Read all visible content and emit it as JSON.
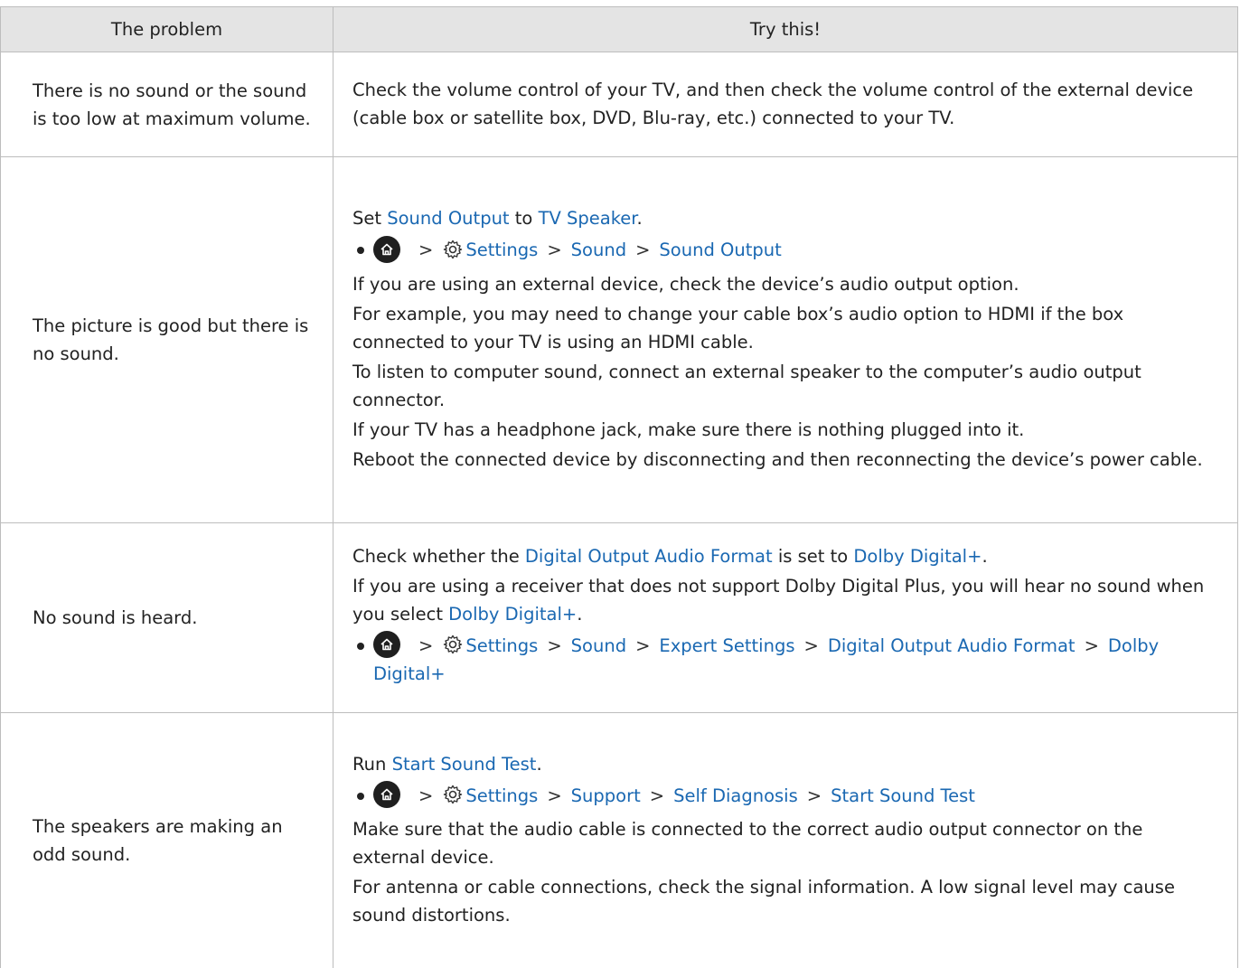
{
  "header": {
    "col1": "The problem",
    "col2": "Try this!"
  },
  "nav": {
    "settings": "Settings",
    "sound": "Sound",
    "sound_output": "Sound Output",
    "expert_settings": "Expert Settings",
    "digital_output_audio_format": "Digital Output Audio Format",
    "dolby_digital_plus": "Dolby Digital+",
    "support": "Support",
    "self_diagnosis": "Self Diagnosis",
    "start_sound_test": "Start Sound Test",
    "tv_speaker": "TV Speaker"
  },
  "rows": [
    {
      "problem": "There is no sound or the sound is too low at maximum volume.",
      "solution": "Check the volume control of your TV, and then check the volume control of the external device (cable box or satellite box, DVD, Blu-ray, etc.) connected to your TV."
    },
    {
      "problem": "The picture is good but there is no sound.",
      "intro_a": "Set ",
      "intro_b": " to ",
      "intro_c": ".",
      "p1": "If you are using an external device, check the device’s audio output option.",
      "p2": "For example, you may need to change your cable box’s audio option to HDMI if the box connected to your TV is using an HDMI cable.",
      "p3": "To listen to computer sound, connect an external speaker to the computer’s audio output connector.",
      "p4": "If your TV has a headphone jack, make sure there is nothing plugged into it.",
      "p5": "Reboot the connected device by disconnecting and then reconnecting the device’s power cable."
    },
    {
      "problem": "No sound is heard.",
      "intro_a": "Check whether the ",
      "intro_b": " is set to ",
      "intro_c": ".",
      "p1a": "If you are using a receiver that does not support Dolby Digital Plus, you will hear no sound when you select ",
      "p1b": "."
    },
    {
      "problem": "The speakers are making an odd sound.",
      "intro_a": "Run ",
      "intro_b": ".",
      "p1": "Make sure that the audio cable is connected to the correct audio output connector on the external device.",
      "p2": "For antenna or cable connections, check the signal information. A low signal level may cause sound distortions."
    }
  ]
}
